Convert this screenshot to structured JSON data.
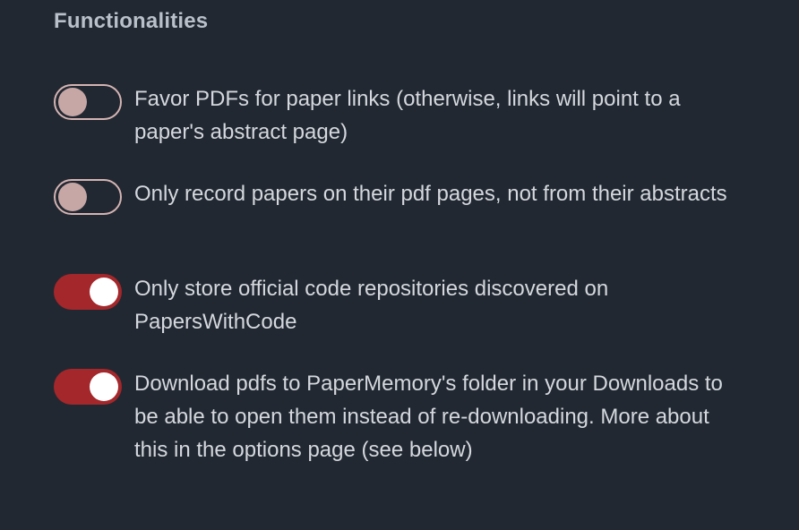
{
  "section": {
    "title": "Functionalities"
  },
  "options": [
    {
      "label": "Favor PDFs for paper links (otherwise, links will point to a paper's abstract page)",
      "enabled": false
    },
    {
      "label": "Only record papers on their pdf pages, not from their abstracts",
      "enabled": false
    },
    {
      "label": "Only store official code repositories discovered on PapersWithCode",
      "enabled": true
    },
    {
      "label": "Download pdfs to PaperMemory's folder in your Downloads to be able to open them instead of re-downloading. More about this in the options page (see below)",
      "enabled": true
    }
  ],
  "colors": {
    "background": "#222831",
    "toggle_on": "#a3272b",
    "toggle_off_border": "#d4b4b4",
    "toggle_off_knob": "#c7a6a6",
    "text": "#d4d8de"
  }
}
